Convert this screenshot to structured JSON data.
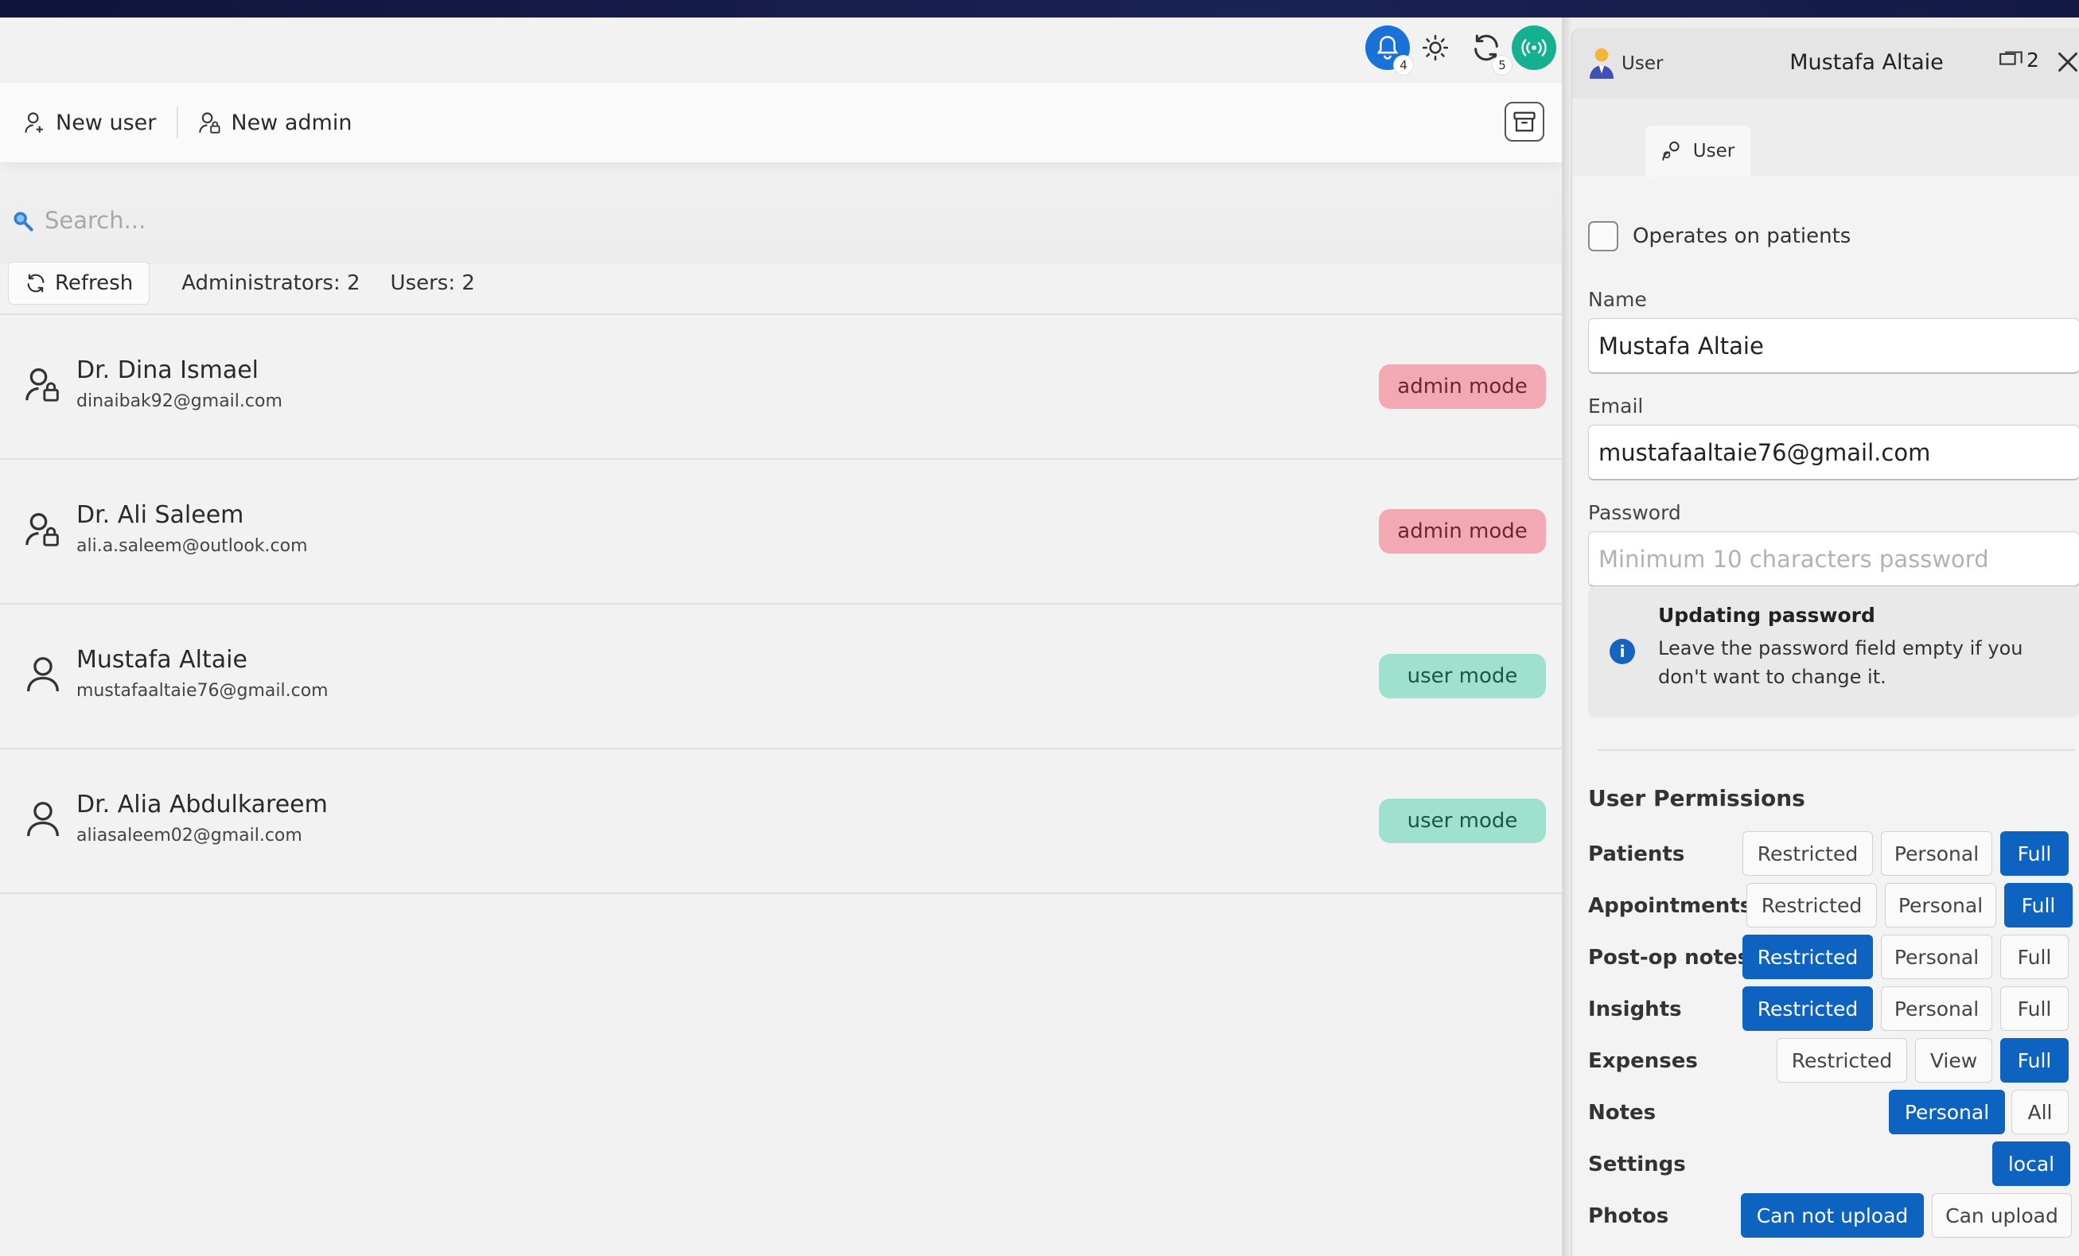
{
  "titlebar": {
    "notifications_count": "4",
    "sync_count": "5"
  },
  "toolbar": {
    "new_user": "New user",
    "new_admin": "New admin"
  },
  "search": {
    "placeholder": "Search..."
  },
  "filters": {
    "refresh": "Refresh",
    "admins": "Administrators: 2",
    "users": "Users: 2"
  },
  "users": [
    {
      "name": "Dr. Dina Ismael",
      "email": "dinaibak92@gmail.com",
      "mode": "admin mode",
      "kind": "admin"
    },
    {
      "name": "Dr. Ali Saleem",
      "email": "ali.a.saleem@outlook.com",
      "mode": "admin mode",
      "kind": "admin"
    },
    {
      "name": "Mustafa Altaie",
      "email": "mustafaaltaie76@gmail.com",
      "mode": "user mode",
      "kind": "user"
    },
    {
      "name": "Dr. Alia Abdulkareem",
      "email": "aliasaleem02@gmail.com",
      "mode": "user mode",
      "kind": "user"
    }
  ],
  "panel": {
    "kind": "User",
    "title": "Mustafa Altaie",
    "window_count": "2",
    "tab": "User",
    "operates_on_patients": "Operates on patients",
    "name_label": "Name",
    "name_value": "Mustafa Altaie",
    "email_label": "Email",
    "email_value": "mustafaaltaie76@gmail.com",
    "password_label": "Password",
    "password_placeholder": "Minimum 10 characters password",
    "info_title": "Updating password",
    "info_text": "Leave the password field empty if you don't want to change it.",
    "permissions_heading": "User Permissions",
    "permissions": [
      {
        "label": "Patients",
        "options": [
          "Restricted",
          "Personal",
          "Full"
        ],
        "selected": "Full"
      },
      {
        "label": "Appointments",
        "options": [
          "Restricted",
          "Personal",
          "Full"
        ],
        "selected": "Full"
      },
      {
        "label": "Post-op notes",
        "options": [
          "Restricted",
          "Personal",
          "Full"
        ],
        "selected": "Restricted"
      },
      {
        "label": "Insights",
        "options": [
          "Restricted",
          "Personal",
          "Full"
        ],
        "selected": "Restricted"
      },
      {
        "label": "Expenses",
        "options": [
          "Restricted",
          "View",
          "Full"
        ],
        "selected": "Full"
      },
      {
        "label": "Notes",
        "options": [
          "Personal",
          "All"
        ],
        "selected": "Personal"
      },
      {
        "label": "Settings",
        "options": [
          "local"
        ],
        "selected": "local"
      },
      {
        "label": "Photos",
        "options": [
          "Can not upload",
          "Can upload"
        ],
        "selected": "Can not upload"
      }
    ]
  },
  "colors": {
    "accent": "#0e62c0",
    "admin_badge": "#f3a9b4",
    "user_badge": "#9fe0cf",
    "online_indicator": "#14b08f"
  }
}
